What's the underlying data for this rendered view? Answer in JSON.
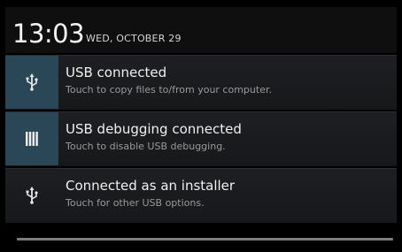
{
  "status": {
    "time": "13:03",
    "date": "WED, OCTOBER 29"
  },
  "notifications": [
    {
      "title": "USB connected",
      "subtitle": "Touch to copy files to/from your computer.",
      "icon": "usb-icon",
      "highlighted": true
    },
    {
      "title": "USB debugging connected",
      "subtitle": "Touch to disable USB debugging.",
      "icon": "debug-bars-icon",
      "highlighted": true
    },
    {
      "title": "Connected as an installer",
      "subtitle": "Touch for other USB options.",
      "icon": "usb-icon",
      "highlighted": false
    }
  ],
  "colors": {
    "highlight_icon_bg": "#2a4758",
    "handle": "#7c7c7c"
  }
}
